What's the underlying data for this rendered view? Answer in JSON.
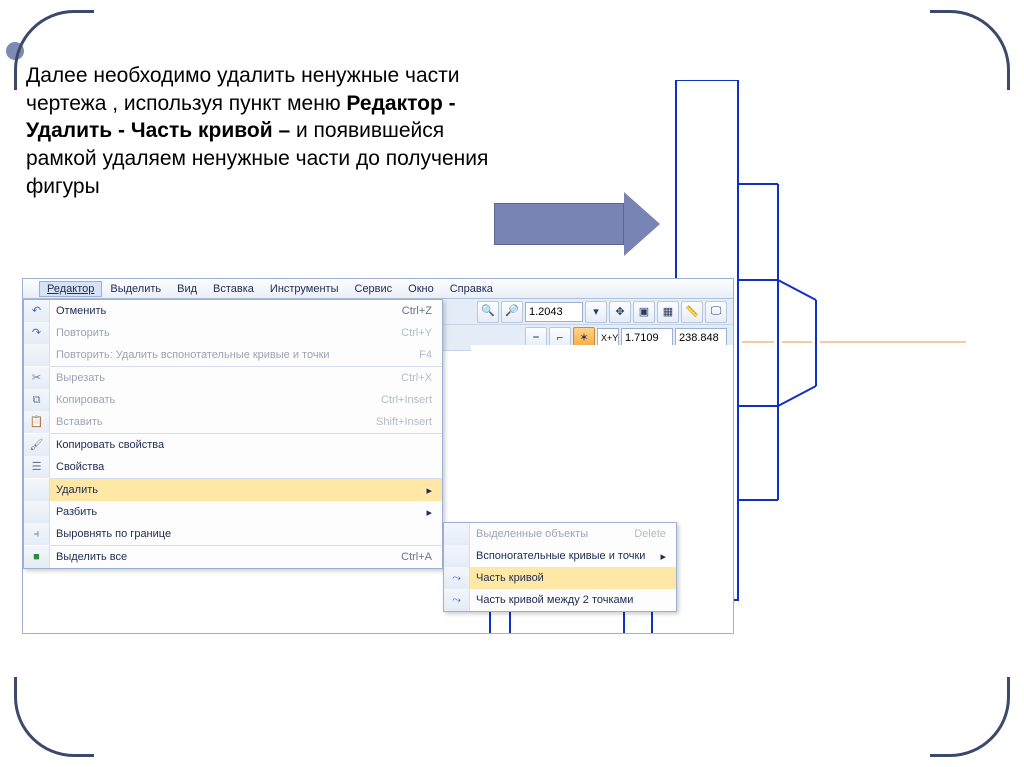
{
  "slide_text": {
    "p1": "Далее необходимо удалить ненужные части чертежа , используя пункт меню ",
    "b1": "Редактор - Удалить  - Часть кривой – ",
    "p2": "и появившейся рамкой удаляем ненужные части до получения  фигуры"
  },
  "menubar": [
    "Редактор",
    "Выделить",
    "Вид",
    "Вставка",
    "Инструменты",
    "Сервис",
    "Окно",
    "Справка"
  ],
  "toolbar": {
    "zoom_field": "1.2043",
    "xy_prefix": "X+Y",
    "coord_x": "1.7109",
    "coord_y": "238.848"
  },
  "menu_items": [
    {
      "icon": "undo",
      "label": "Отменить",
      "shortcut": "Ctrl+Z",
      "disabled": false
    },
    {
      "icon": "redo",
      "label": "Повторить",
      "shortcut": "Ctrl+Y",
      "disabled": true
    },
    {
      "icon": "",
      "label": "Повторить: Удалить вспонотательные кривые и точки",
      "shortcut": "F4",
      "disabled": true,
      "sep_after": true
    },
    {
      "icon": "cut",
      "label": "Вырезать",
      "shortcut": "Ctrl+X",
      "disabled": true
    },
    {
      "icon": "copy",
      "label": "Копировать",
      "shortcut": "Ctrl+Insert",
      "disabled": true
    },
    {
      "icon": "paste",
      "label": "Вставить",
      "shortcut": "Shift+Insert",
      "disabled": true,
      "sep_after": true
    },
    {
      "icon": "brush",
      "label": "Копировать свойства",
      "shortcut": "",
      "disabled": false
    },
    {
      "icon": "props",
      "label": "Свойства",
      "shortcut": "",
      "disabled": false,
      "sep_after": true
    },
    {
      "icon": "",
      "label": "Удалить",
      "shortcut": "",
      "disabled": false,
      "hover": true,
      "submenu": true
    },
    {
      "icon": "",
      "label": "Разбить",
      "shortcut": "",
      "disabled": false,
      "submenu": true
    },
    {
      "icon": "align",
      "label": "Выровнять по границе",
      "shortcut": "",
      "disabled": false,
      "sep_after": true
    },
    {
      "icon": "selall",
      "label": "Выделить все",
      "shortcut": "Ctrl+A",
      "disabled": false
    }
  ],
  "submenu_items": [
    {
      "icon": "",
      "label": "Выделенные объекты",
      "shortcut": "Delete",
      "disabled": true
    },
    {
      "icon": "",
      "label": "Вспоногательные кривые и точки",
      "shortcut": "",
      "disabled": false,
      "submenu": true
    },
    {
      "icon": "curve",
      "label": "Часть кривой",
      "shortcut": "",
      "disabled": false,
      "hover": true
    },
    {
      "icon": "curve2",
      "label": "Часть кривой между 2 точками",
      "shortcut": "",
      "disabled": false
    }
  ]
}
